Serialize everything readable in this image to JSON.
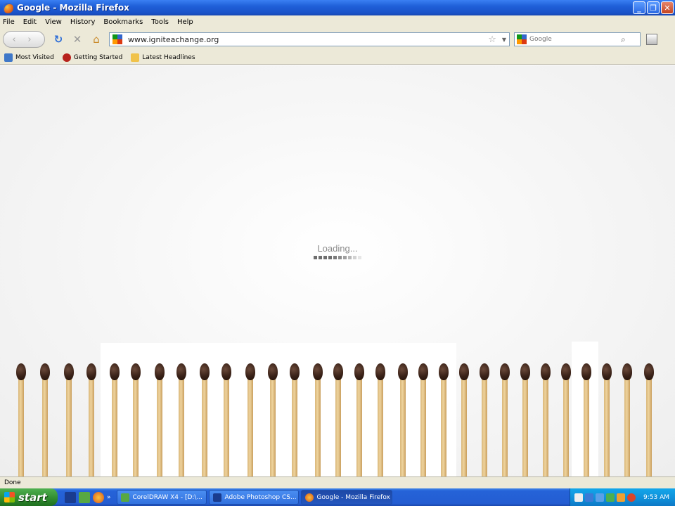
{
  "window": {
    "title": "Google - Mozilla Firefox",
    "minimize": "_",
    "maximize": "❐",
    "close": "✕"
  },
  "menu": [
    "File",
    "Edit",
    "View",
    "History",
    "Bookmarks",
    "Tools",
    "Help"
  ],
  "nav": {
    "back": "‹",
    "forward": "›",
    "url": "www.igniteachange.org",
    "search_placeholder": "Google"
  },
  "bookmarks": [
    "Most Visited",
    "Getting Started",
    "Latest Headlines"
  ],
  "content": {
    "loading_text": "Loading...",
    "loader_colors": [
      "#6e6e6e",
      "#6e6e6e",
      "#6e6e6e",
      "#6e6e6e",
      "#7a7a7a",
      "#8c8c8c",
      "#a0a0a0",
      "#b8b8b8",
      "#d2d2d2",
      "#e6e6e6"
    ]
  },
  "status": {
    "text": "Done"
  },
  "taskbar": {
    "start_label": "start",
    "more": "»",
    "tasks": [
      "CorelDRAW X4 - [D:\\...",
      "Adobe Photoshop CS...",
      "Google - Mozilla Firefox"
    ],
    "clock": "9:53 AM"
  }
}
